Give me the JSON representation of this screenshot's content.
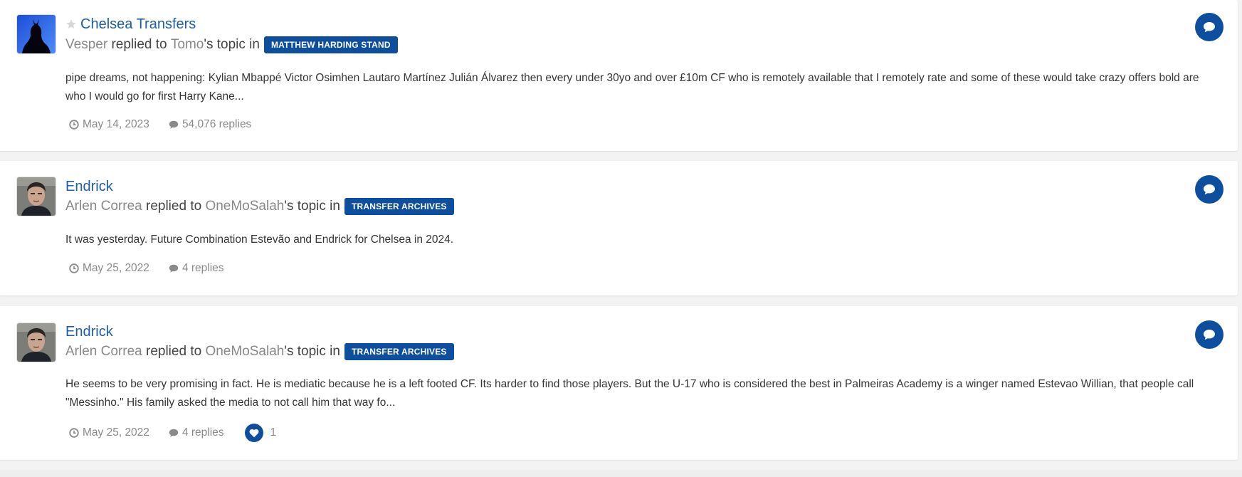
{
  "colors": {
    "accent": "#0d4f9e",
    "link": "#1f5ea8",
    "muted": "#888888",
    "background": "#f3f3f3"
  },
  "items": [
    {
      "title": "Chelsea Transfers",
      "starred": true,
      "author": "Vesper",
      "action": "replied to",
      "topic_owner": "Tomo",
      "possessive": "'s topic in",
      "forum": "MATTHEW HARDING STAND",
      "snippet": "pipe dreams, not happening: Kylian Mbappé Victor Osimhen Lautaro Martínez Julián Álvarez then every under 30yo and over £10m CF who is remotely available that I remotely rate and some of these would take crazy offers bold are who I would go for first Harry Kane...",
      "date": "May 14, 2023",
      "replies": "54,076 replies",
      "avatar_icon": "silhouette-avatar",
      "type_icon": "comment-icon"
    },
    {
      "title": "Endrick",
      "starred": false,
      "author": "Arlen Correa",
      "action": "replied to",
      "topic_owner": "OneMoSalah",
      "possessive": "'s topic in",
      "forum": "TRANSFER ARCHIVES",
      "snippet": "It was yesterday. Future Combination Estevão and Endrick for Chelsea in 2024.",
      "date": "May 25, 2022",
      "replies": "4 replies",
      "avatar_icon": "user-photo-avatar",
      "type_icon": "comment-icon"
    },
    {
      "title": "Endrick",
      "starred": false,
      "author": "Arlen Correa",
      "action": "replied to",
      "topic_owner": "OneMoSalah",
      "possessive": "'s topic in",
      "forum": "TRANSFER ARCHIVES",
      "snippet": "He seems to be very promising in fact. He is mediatic because he is a left footed CF. Its harder to find those players. But the U-17 who is considered the best in Palmeiras Academy is a winger named Estevao Willian, that people call \"Messinho.\" His family asked the media to not call him that way fo...",
      "date": "May 25, 2022",
      "replies": "4 replies",
      "reaction_count": "1",
      "avatar_icon": "user-photo-avatar",
      "type_icon": "comment-icon"
    }
  ]
}
